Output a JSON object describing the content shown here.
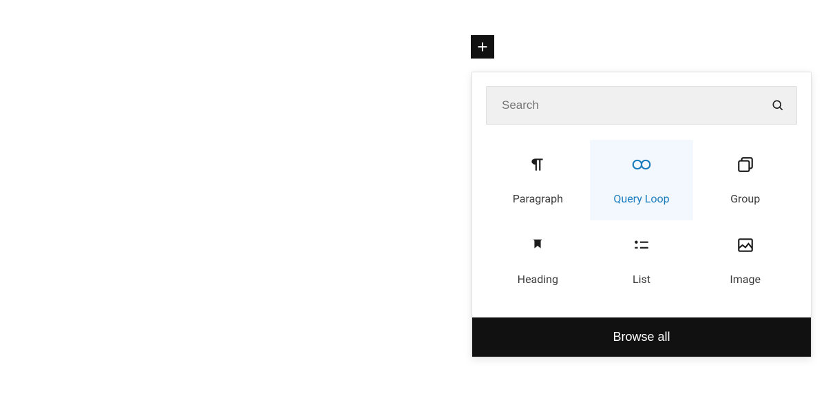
{
  "search": {
    "placeholder": "Search"
  },
  "blocks": [
    {
      "label": "Paragraph"
    },
    {
      "label": "Query Loop"
    },
    {
      "label": "Group"
    },
    {
      "label": "Heading"
    },
    {
      "label": "List"
    },
    {
      "label": "Image"
    }
  ],
  "browse_all": "Browse all"
}
